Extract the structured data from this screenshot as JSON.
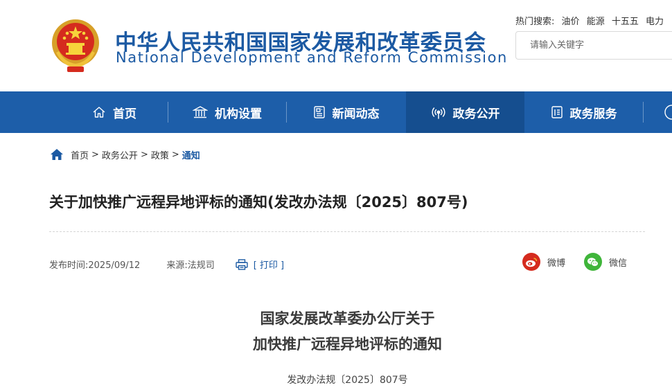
{
  "header": {
    "org_name_cn": "中华人民共和国国家发展和改革委员会",
    "org_name_en": "National Development and Reform Commission",
    "hot_search_label": "热门搜索:",
    "hot_keywords": [
      "油价",
      "能源",
      "十五五",
      "电力"
    ],
    "search_placeholder": "请输入关键字",
    "emblem_icon": "national-emblem"
  },
  "nav": {
    "items": [
      {
        "label": "首页",
        "icon": "home-icon"
      },
      {
        "label": "机构设置",
        "icon": "institution-icon"
      },
      {
        "label": "新闻动态",
        "icon": "news-icon"
      },
      {
        "label": "政务公开",
        "icon": "broadcast-icon",
        "active": true
      },
      {
        "label": "政务服务",
        "icon": "document-icon"
      }
    ]
  },
  "breadcrumb": {
    "items": [
      "首页",
      "政务公开",
      "政策"
    ],
    "current": "通知",
    "separator": ">"
  },
  "article": {
    "title": "关于加快推广远程异地评标的通知(发改办法规〔2025〕807号)",
    "publish_time": "发布时间:2025/09/12",
    "source": "来源:法规司",
    "print_label": "[ 打印 ]",
    "share": {
      "weibo": "微博",
      "wechat": "微信"
    },
    "doc_heading_line1": "国家发展改革委办公厅关于",
    "doc_heading_line2": "加快推广远程异地评标的通知",
    "doc_number": "发改办法规〔2025〕807号"
  },
  "colors": {
    "brand_blue": "#1d5ea9",
    "nav_active": "#154e8f",
    "weibo_red": "#d52b1e",
    "wechat_green": "#3fb53a"
  }
}
